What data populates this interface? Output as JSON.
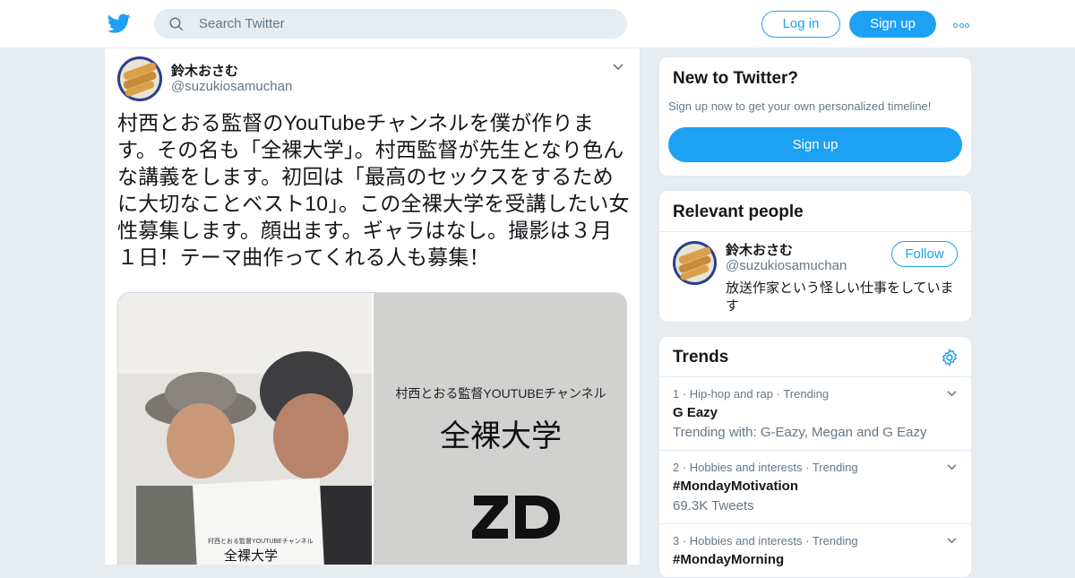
{
  "header": {
    "search_placeholder": "Search Twitter",
    "login_label": "Log in",
    "signup_label": "Sign up",
    "brand_color": "#1da1f2"
  },
  "tweet": {
    "author_name": "鈴木おさむ",
    "author_handle": "@suzukiosamuchan",
    "text": "村西とおる監督のYouTubeチャンネルを僕が作ります。その名も「全裸大学」。村西監督が先生となり色んな講義をします。初回は「最高のセックスをするために大切なことベスト10」。この全裸大学を受講したい女性募集します。顔出ます。ギャラはなし。撮影は３月１日！テーマ曲作ってくれる人も募集！",
    "media": {
      "doc_title": "村西とおる監督YOUTUBEチャンネル",
      "doc_big": "全裸大学",
      "doc_logo": "ZD",
      "small_doc_title": "村西とおる監督YOUTUBEチャンネル",
      "small_doc_big": "全裸大学"
    }
  },
  "sidebar": {
    "new_card": {
      "title": "New to Twitter?",
      "subtitle": "Sign up now to get your own personalized timeline!",
      "button": "Sign up"
    },
    "relevant": {
      "title": "Relevant people",
      "name": "鈴木おさむ",
      "handle": "@suzukiosamuchan",
      "follow": "Follow",
      "bio": "放送作家という怪しい仕事をしています"
    },
    "trends": {
      "title": "Trends",
      "items": [
        {
          "meta": "1 · Hip-hop and rap · Trending",
          "name": "G Eazy",
          "desc": "Trending with: G-Eazy, Megan and G Eazy"
        },
        {
          "meta": "2 · Hobbies and interests · Trending",
          "name": "#MondayMotivation",
          "desc": "69.3K Tweets"
        },
        {
          "meta": "3 · Hobbies and interests · Trending",
          "name": "#MondayMorning",
          "desc": ""
        }
      ]
    }
  }
}
